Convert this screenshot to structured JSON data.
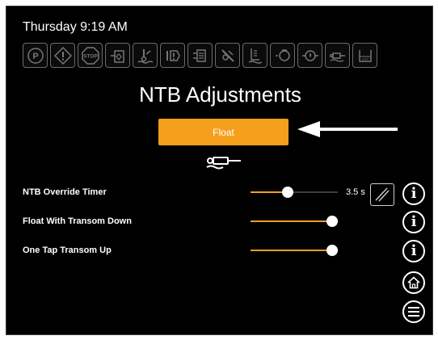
{
  "status": {
    "clock": "Thursday 9:19 AM"
  },
  "top_icons": [
    "parking-brake-icon",
    "warning-icon",
    "stop-icon",
    "fuel-tank-icon",
    "water-temp-icon",
    "engine-warning-icon",
    "transmission-icon",
    "no-service-icon",
    "oil-level-icon",
    "engine-icon",
    "oil-pressure-icon",
    "trim-cylinder-icon",
    "fuel-filter-icon"
  ],
  "page": {
    "title": "NTB Adjustments"
  },
  "float_button": {
    "label": "Float"
  },
  "settings": [
    {
      "label": "NTB Override Timer",
      "level": 0.42,
      "value": "3.5 s"
    },
    {
      "label": "Float With Transom Down",
      "level": 1.0
    },
    {
      "label": "One Tap Transom Up",
      "level": 1.0
    }
  ],
  "colors": {
    "accent": "#f59f1d",
    "background": "#000000",
    "text": "#ffffff"
  }
}
